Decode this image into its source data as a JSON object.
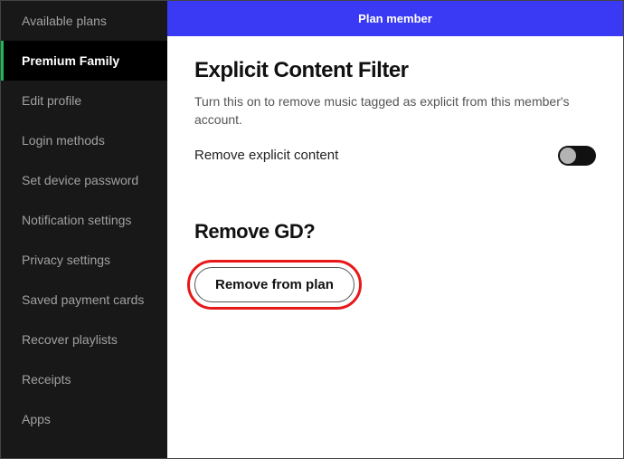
{
  "sidebar": {
    "items": [
      {
        "label": "Available plans"
      },
      {
        "label": "Premium Family"
      },
      {
        "label": "Edit profile"
      },
      {
        "label": "Login methods"
      },
      {
        "label": "Set device password"
      },
      {
        "label": "Notification settings"
      },
      {
        "label": "Privacy settings"
      },
      {
        "label": "Saved payment cards"
      },
      {
        "label": "Recover playlists"
      },
      {
        "label": "Receipts"
      },
      {
        "label": "Apps"
      }
    ],
    "active_index": 1
  },
  "banner": {
    "title": "Plan member"
  },
  "explicit": {
    "heading": "Explicit Content Filter",
    "description": "Turn this on to remove music tagged as explicit from this member's account.",
    "toggle_label": "Remove explicit content",
    "toggle_on": false
  },
  "remove_section": {
    "heading": "Remove GD?",
    "button_label": "Remove from plan"
  }
}
